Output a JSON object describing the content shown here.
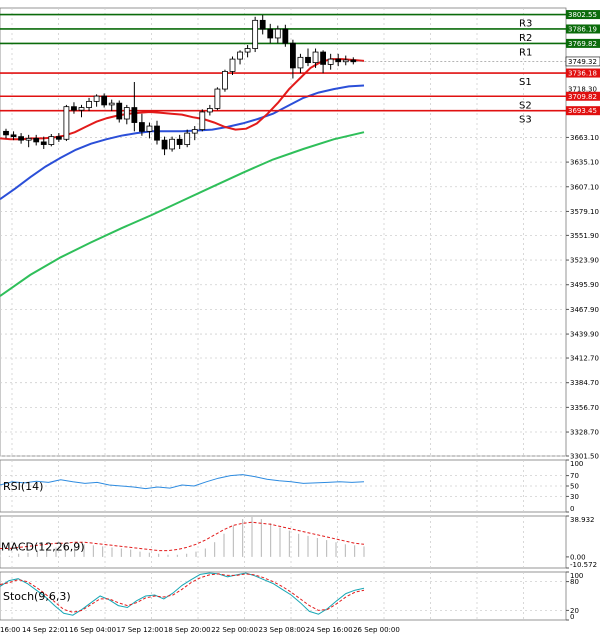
{
  "chart_data": {
    "type": "candlestick",
    "main_panel": {
      "y_ticks": [
        "3663.10",
        "3635.10",
        "3607.10",
        "3579.10",
        "3551.90",
        "3523.90",
        "3495.90",
        "3467.90",
        "3439.90",
        "3412.70",
        "3384.70",
        "3356.70",
        "3328.70",
        "3301.50"
      ],
      "ylim": [
        3301.5,
        3810
      ],
      "current_price": "3749.32",
      "levels": [
        {
          "label": "R3",
          "value": 3802.55,
          "text": "3802.55",
          "color": "#0b6b0b"
        },
        {
          "label": "R2",
          "value": 3786.19,
          "text": "3786.19",
          "color": "#0b6b0b"
        },
        {
          "label": "R1",
          "value": 3769.82,
          "text": "3769.82",
          "color": "#0b6b0b"
        },
        {
          "label": "S1",
          "value": 3736.18,
          "text": "3736.18",
          "color": "#e01010"
        },
        {
          "label": "S2",
          "value": 3709.82,
          "text": "3709.82",
          "color": "#e01010"
        },
        {
          "label": "S3",
          "value": 3693.45,
          "text": "3693.45",
          "color": "#e01010"
        }
      ],
      "extra_tags": [
        "3718.30"
      ],
      "candles": [
        [
          3670,
          3673,
          3662,
          3666
        ],
        [
          3666,
          3670,
          3660,
          3664
        ],
        [
          3664,
          3668,
          3656,
          3660
        ],
        [
          3660,
          3666,
          3652,
          3662
        ],
        [
          3662,
          3666,
          3654,
          3658
        ],
        [
          3658,
          3664,
          3650,
          3655
        ],
        [
          3655,
          3667,
          3653,
          3664
        ],
        [
          3664,
          3668,
          3658,
          3661
        ],
        [
          3661,
          3700,
          3659,
          3698
        ],
        [
          3698,
          3703,
          3690,
          3694
        ],
        [
          3694,
          3700,
          3686,
          3697
        ],
        [
          3697,
          3708,
          3693,
          3704
        ],
        [
          3704,
          3712,
          3698,
          3710
        ],
        [
          3710,
          3713,
          3697,
          3700
        ],
        [
          3700,
          3706,
          3693,
          3702
        ],
        [
          3702,
          3705,
          3680,
          3684
        ],
        [
          3684,
          3700,
          3678,
          3697
        ],
        [
          3697,
          3726,
          3670,
          3680
        ],
        [
          3680,
          3690,
          3665,
          3670
        ],
        [
          3670,
          3680,
          3662,
          3676
        ],
        [
          3676,
          3682,
          3655,
          3660
        ],
        [
          3660,
          3664,
          3643,
          3650
        ],
        [
          3650,
          3664,
          3647,
          3661
        ],
        [
          3661,
          3666,
          3650,
          3655
        ],
        [
          3655,
          3672,
          3652,
          3668
        ],
        [
          3668,
          3676,
          3660,
          3672
        ],
        [
          3672,
          3695,
          3670,
          3692
        ],
        [
          3692,
          3700,
          3688,
          3696
        ],
        [
          3696,
          3720,
          3694,
          3718
        ],
        [
          3718,
          3740,
          3715,
          3738
        ],
        [
          3738,
          3755,
          3734,
          3752
        ],
        [
          3752,
          3762,
          3746,
          3760
        ],
        [
          3760,
          3768,
          3754,
          3764
        ],
        [
          3764,
          3800,
          3760,
          3796
        ],
        [
          3796,
          3802,
          3780,
          3786
        ],
        [
          3786,
          3792,
          3770,
          3776
        ],
        [
          3776,
          3790,
          3770,
          3786
        ],
        [
          3786,
          3791,
          3766,
          3770
        ],
        [
          3770,
          3774,
          3730,
          3742
        ],
        [
          3742,
          3758,
          3736,
          3754
        ],
        [
          3754,
          3764,
          3744,
          3748
        ],
        [
          3748,
          3764,
          3742,
          3760
        ],
        [
          3760,
          3762,
          3736,
          3746
        ],
        [
          3746,
          3758,
          3740,
          3752
        ],
        [
          3752,
          3758,
          3744,
          3749
        ],
        [
          3749,
          3756,
          3745,
          3751
        ],
        [
          3751,
          3754,
          3746,
          3749
        ]
      ],
      "ma_red": [
        3662,
        3661,
        3661,
        3662,
        3662,
        3663,
        3665,
        3669,
        3675,
        3681,
        3685,
        3688,
        3690,
        3691,
        3692,
        3691,
        3690,
        3689,
        3686,
        3684,
        3680,
        3675,
        3672,
        3673,
        3679,
        3690,
        3703,
        3718,
        3730,
        3742,
        3749,
        3752,
        3752,
        3751,
        3750
      ],
      "ma_blue": [
        3593,
        3605,
        3618,
        3630,
        3640,
        3649,
        3656,
        3661,
        3665,
        3668,
        3670,
        3670,
        3670,
        3671,
        3672,
        3675,
        3679,
        3684,
        3690,
        3699,
        3708,
        3714,
        3718,
        3721,
        3722
      ],
      "ma_green": [
        3483,
        3507,
        3527,
        3544,
        3560,
        3575,
        3591,
        3607,
        3623,
        3638,
        3650,
        3661,
        3669
      ]
    },
    "x_ticks": [
      "16:00",
      "14 Sep 22:01",
      "16 Sep 04:00",
      "17 Sep 12:00",
      "18 Sep 20:00",
      "22 Sep 00:00",
      "23 Sep 08:00",
      "24 Sep 16:00",
      "26 Sep 00:00"
    ],
    "rsi": {
      "label": "RSI(14)",
      "y_ticks": [
        "100",
        "70",
        "50",
        "30",
        "0"
      ],
      "values": [
        52,
        58,
        56,
        59,
        57,
        62,
        58,
        55,
        57,
        52,
        50,
        48,
        45,
        48,
        46,
        52,
        50,
        58,
        65,
        70,
        72,
        68,
        63,
        60,
        58,
        55,
        56,
        57,
        58,
        57,
        58
      ]
    },
    "macd": {
      "label": "MACD(12,26,9)",
      "y_ticks": [
        "38.932",
        "0.00",
        "-10.572"
      ],
      "bars": [
        2,
        1,
        3,
        4,
        6,
        8,
        9,
        10,
        11,
        12,
        11,
        10,
        9,
        8,
        7,
        5,
        4,
        3,
        2,
        2,
        3,
        5,
        8,
        14,
        22,
        30,
        36,
        38,
        36,
        32,
        28,
        25,
        22,
        20,
        18,
        16,
        14,
        12,
        11,
        10
      ],
      "signal": [
        8,
        8,
        9,
        10,
        11,
        12,
        13,
        13,
        14,
        14,
        13,
        12,
        11,
        10,
        9,
        8,
        7,
        6,
        6,
        7,
        9,
        12,
        16,
        21,
        26,
        30,
        32,
        33,
        32,
        31,
        29,
        27,
        25,
        23,
        21,
        19,
        17,
        15,
        13,
        12
      ]
    },
    "stoch": {
      "label": "Stoch(9,6,3)",
      "y_ticks": [
        "100",
        "80",
        "20",
        "0"
      ],
      "k": [
        70,
        82,
        86,
        76,
        62,
        48,
        30,
        14,
        10,
        22,
        36,
        50,
        42,
        30,
        26,
        40,
        50,
        52,
        44,
        56,
        72,
        84,
        95,
        98,
        96,
        90,
        94,
        98,
        92,
        84,
        76,
        64,
        52,
        36,
        18,
        12,
        24,
        40,
        55,
        62,
        66
      ],
      "d": [
        74,
        78,
        84,
        80,
        68,
        54,
        38,
        22,
        16,
        20,
        32,
        44,
        44,
        36,
        30,
        36,
        46,
        50,
        48,
        52,
        64,
        78,
        88,
        94,
        96,
        93,
        93,
        96,
        94,
        88,
        80,
        70,
        58,
        44,
        30,
        20,
        22,
        34,
        48,
        58,
        62
      ]
    }
  }
}
